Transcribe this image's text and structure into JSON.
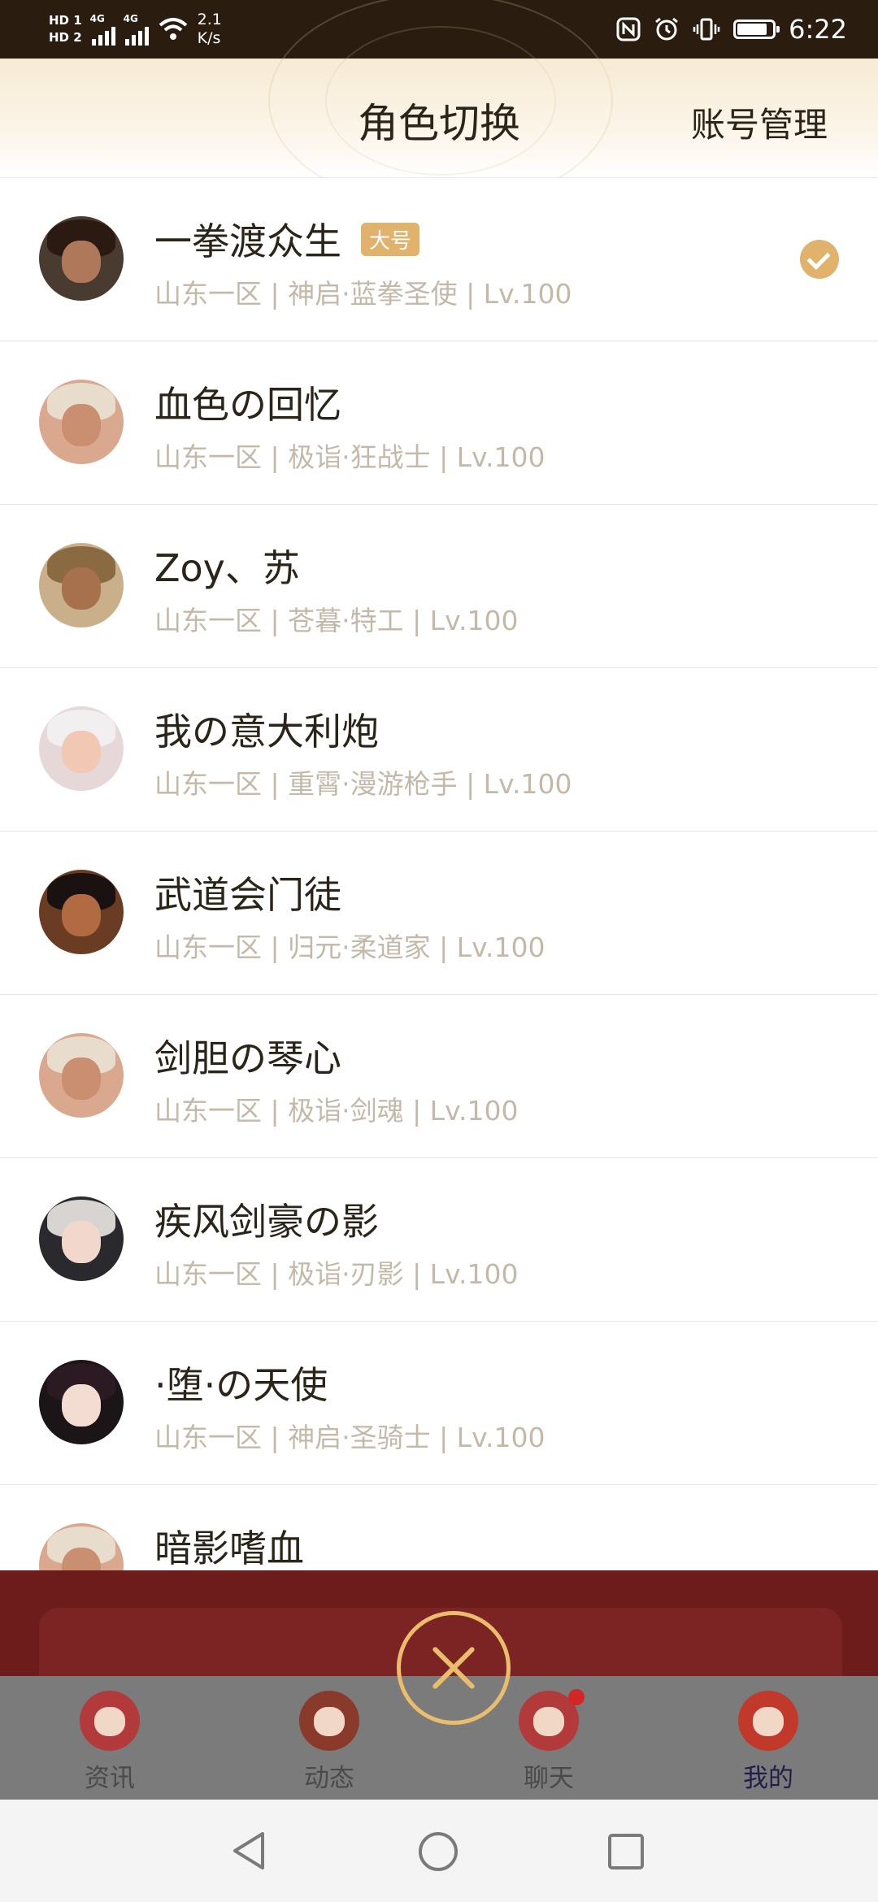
{
  "status_bar": {
    "hd1": "HD 1",
    "hd2": "HD 2",
    "net1": "4G",
    "net2": "4G",
    "speed_value": "2.1",
    "speed_unit": "K/s",
    "time": "6:22",
    "battery_level": 0.9
  },
  "header": {
    "title": "角色切换",
    "account_manage": "账号管理"
  },
  "roles": [
    {
      "name": "一拳渡众生",
      "badge": "大号",
      "meta": "山东一区 | 神启·蓝拳圣使 | Lv.100",
      "selected": true
    },
    {
      "name": "血色の回忆",
      "meta": "山东一区 | 极诣·狂战士 | Lv.100"
    },
    {
      "name": "Zoy、苏",
      "meta": "山东一区 | 苍暮·特工 | Lv.100"
    },
    {
      "name": "我の意大利炮",
      "meta": "山东一区 | 重霄·漫游枪手 | Lv.100"
    },
    {
      "name": "武道会门徒",
      "meta": "山东一区 | 归元·柔道家 | Lv.100"
    },
    {
      "name": "剑胆の琴心",
      "meta": "山东一区 | 极诣·剑魂 | Lv.100"
    },
    {
      "name": "疾风剑豪の影",
      "meta": "山东一区 | 极诣·刃影 | Lv.100"
    },
    {
      "name": "·堕·の天使",
      "meta": "山东一区 | 神启·圣骑士 | Lv.100"
    },
    {
      "name": "暗影嗜血"
    }
  ],
  "tabs": [
    {
      "label": "资讯"
    },
    {
      "label": "动态"
    },
    {
      "label": "聊天"
    },
    {
      "label": "我的"
    }
  ]
}
